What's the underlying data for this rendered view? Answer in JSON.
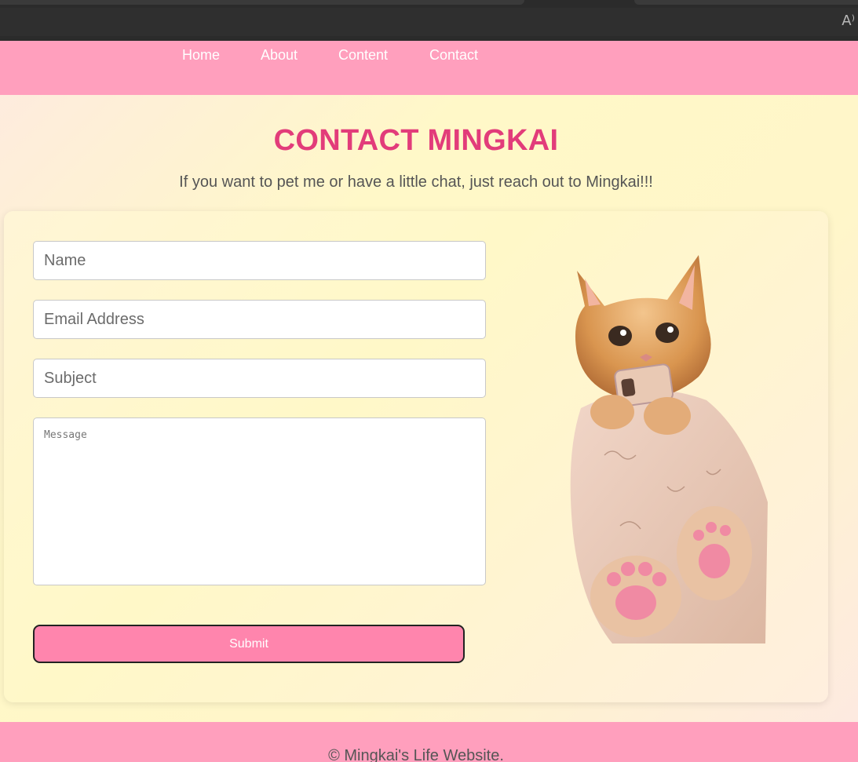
{
  "browser": {
    "read_aloud_glyph": "A⁾"
  },
  "nav": {
    "items": [
      "Home",
      "About",
      "Content",
      "Contact"
    ]
  },
  "hero": {
    "title": "CONTACT MINGKAI",
    "subtitle": "If you want to pet me or have a little chat, just reach out to Mingkai!!!"
  },
  "form": {
    "name_placeholder": "Name",
    "email_placeholder": "Email Address",
    "subject_placeholder": "Subject",
    "message_placeholder": "Message",
    "submit_label": "Submit"
  },
  "colors": {
    "nav_bg": "#ff9fbd",
    "title": "#e23c7a",
    "submit_bg": "#ff85ad",
    "footer_bg": "#ff9fbd"
  },
  "footer": {
    "text": "© Mingkai's Life Website."
  }
}
